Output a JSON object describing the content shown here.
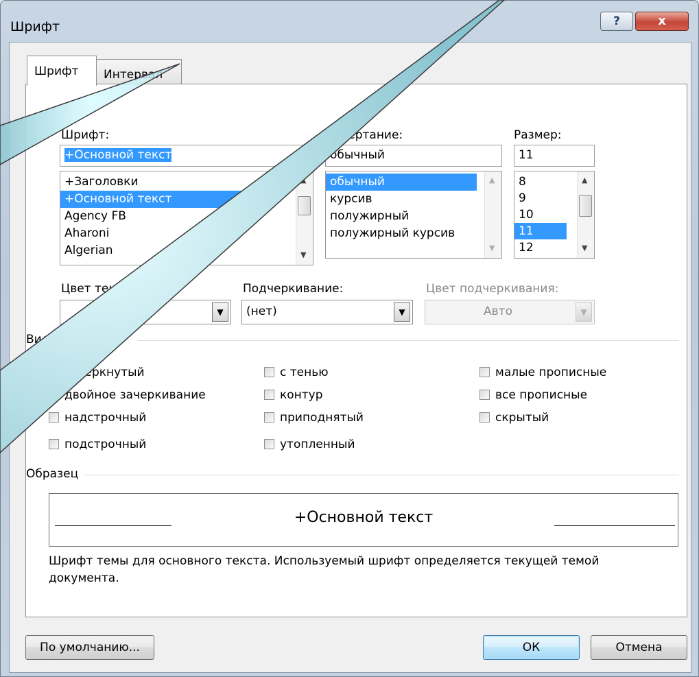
{
  "window": {
    "title": "Шрифт",
    "help_label": "?",
    "close_label": "x"
  },
  "tabs": [
    {
      "label": "Шрифт"
    },
    {
      "label": "Интервал"
    }
  ],
  "font": {
    "label": "Шрифт:",
    "value": "+Основной текст",
    "items": [
      "+Заголовки",
      "+Основной текст",
      "Agency FB",
      "Aharoni",
      "Algerian"
    ],
    "selected_index": 1
  },
  "style": {
    "label": "Начертание:",
    "value": "обычный",
    "items": [
      "обычный",
      "курсив",
      "полужирный",
      "полужирный курсив"
    ],
    "selected_index": 0
  },
  "size": {
    "label": "Размер:",
    "value": "11",
    "items": [
      "8",
      "9",
      "10",
      "11",
      "12"
    ],
    "selected_index": 3
  },
  "color": {
    "label": "Цвет текста:",
    "value": ""
  },
  "underline": {
    "label": "Подчеркивание:",
    "value": "(нет)"
  },
  "underline_color": {
    "label": "Цвет подчеркивания:",
    "value": "Авто"
  },
  "modifications": {
    "label": "Видоизменение",
    "items": [
      {
        "label": "зачеркнутый",
        "checked": false
      },
      {
        "label": "двойное зачеркивание",
        "checked": false
      },
      {
        "label": "надстрочный",
        "checked": false
      },
      {
        "label": "подстрочный",
        "checked": false
      },
      {
        "label": "с тенью",
        "checked": false
      },
      {
        "label": "контур",
        "checked": false
      },
      {
        "label": "приподнятый",
        "checked": false
      },
      {
        "label": "утопленный",
        "checked": false
      },
      {
        "label": "малые прописные",
        "checked": false
      },
      {
        "label": "все прописные",
        "checked": false
      },
      {
        "label": "скрытый",
        "checked": false
      }
    ]
  },
  "sample": {
    "label": "Образец",
    "text": "+Основной текст",
    "description": "Шрифт темы для основного текста. Используемый шрифт определяется текущей темой документа."
  },
  "buttons": {
    "default": "По умолчанию...",
    "ok": "ОК",
    "cancel": "Отмена"
  },
  "colors": {
    "selection": "#3399ff",
    "overlay_fill": "#c4f3ff",
    "titlebar": "#c9d6e4"
  }
}
